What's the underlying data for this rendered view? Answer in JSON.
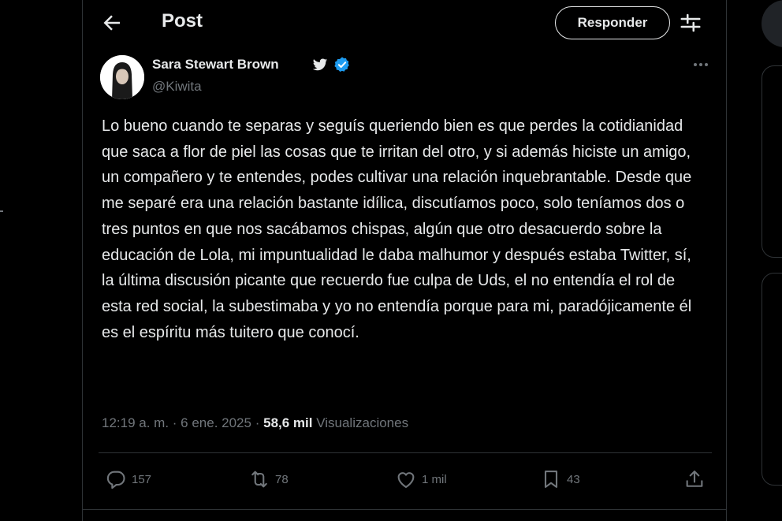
{
  "header": {
    "title": "Post",
    "reply_label": "Responder"
  },
  "post": {
    "author_name": "Sara Stewart Brown",
    "handle": "@Kiwita",
    "text": "Lo bueno cuando te separas y seguís queriendo bien es que perdes la cotidianidad que saca a flor de piel las cosas que te irritan del otro, y si además hiciste un amigo, un compañero y te entendes, podes cultivar una relación inquebrantable. Desde que me separé era una relación bastante idílica, discutíamos poco, solo teníamos dos o tres puntos en que nos sacábamos chispas, algún que otro desacuerdo sobre la educación de Lola, mi impuntualidad le daba malhumor y después estaba Twitter, sí, la última discusión picante que recuerdo fue culpa de Uds, el no entendía el rol de esta red social, la subestimaba y yo no entendía porque para mi, paradójicamente él es el espíritu más tuitero que conocí.",
    "timestamp": "12:19 a. m. · 6 ene. 2025",
    "separator": "·",
    "views_count": "58,6 mil",
    "views_label": "Visualizaciones"
  },
  "actions": {
    "replies": "157",
    "reposts": "78",
    "likes": "1 mil",
    "bookmarks": "43"
  },
  "icons": {
    "back": "arrow-left-icon",
    "settings": "sliders-icon",
    "bird": "twitter-bird-icon",
    "verified": "verified-badge-icon",
    "more": "more-dots-icon",
    "reply": "comment-bubble-icon",
    "repost": "repost-arrows-icon",
    "like": "heart-icon",
    "bookmark": "bookmark-icon",
    "share": "share-upload-icon"
  },
  "colors": {
    "background": "#000000",
    "text": "#e7e9ea",
    "secondary": "#71767b",
    "verified": "#1d9bf0",
    "border": "#2f3336"
  }
}
